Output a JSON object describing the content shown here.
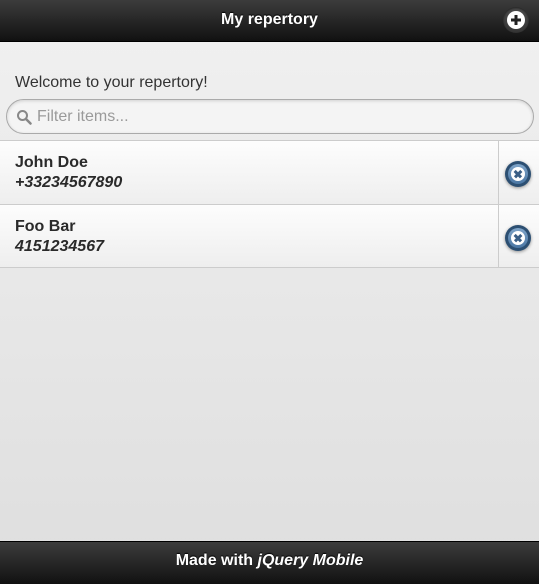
{
  "header": {
    "title": "My repertory",
    "add_icon": "plus-circle-icon"
  },
  "main": {
    "welcome": "Welcome to your repertory!",
    "search": {
      "placeholder": "Filter items...",
      "value": "",
      "icon": "search-icon"
    },
    "contacts": [
      {
        "name": "John Doe",
        "phone": "+33234567890",
        "delete_icon": "delete-icon"
      },
      {
        "name": "Foo Bar",
        "phone": "4151234567",
        "delete_icon": "delete-icon"
      }
    ]
  },
  "footer": {
    "prefix": "Made with",
    "emphasis": "jQuery Mobile"
  },
  "colors": {
    "bar_dark": "#111111",
    "bar_light": "#3c3c3c",
    "delete_accent": "#4a76a3"
  }
}
